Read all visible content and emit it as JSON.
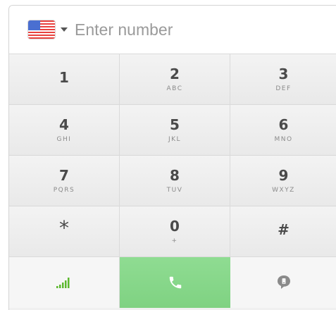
{
  "input": {
    "country_flag_icon": "us-flag-icon",
    "placeholder": "Enter number",
    "value": ""
  },
  "keypad": [
    {
      "digit": "1",
      "letters": ""
    },
    {
      "digit": "2",
      "letters": "ABC"
    },
    {
      "digit": "3",
      "letters": "DEF"
    },
    {
      "digit": "4",
      "letters": "GHI"
    },
    {
      "digit": "5",
      "letters": "JKL"
    },
    {
      "digit": "6",
      "letters": "MNO"
    },
    {
      "digit": "7",
      "letters": "PQRS"
    },
    {
      "digit": "8",
      "letters": "TUV"
    },
    {
      "digit": "9",
      "letters": "WXYZ"
    },
    {
      "digit": "*",
      "letters": ""
    },
    {
      "digit": "0",
      "letters": "+"
    },
    {
      "digit": "#",
      "letters": ""
    }
  ],
  "bottom": {
    "signal_icon": "signal-strength-icon",
    "call_icon": "phone-icon",
    "chat_icon": "chat-bubble-icon"
  },
  "colors": {
    "call_green": "#86d889",
    "signal_green": "#5cb82e",
    "key_text": "#4a4a4a"
  }
}
